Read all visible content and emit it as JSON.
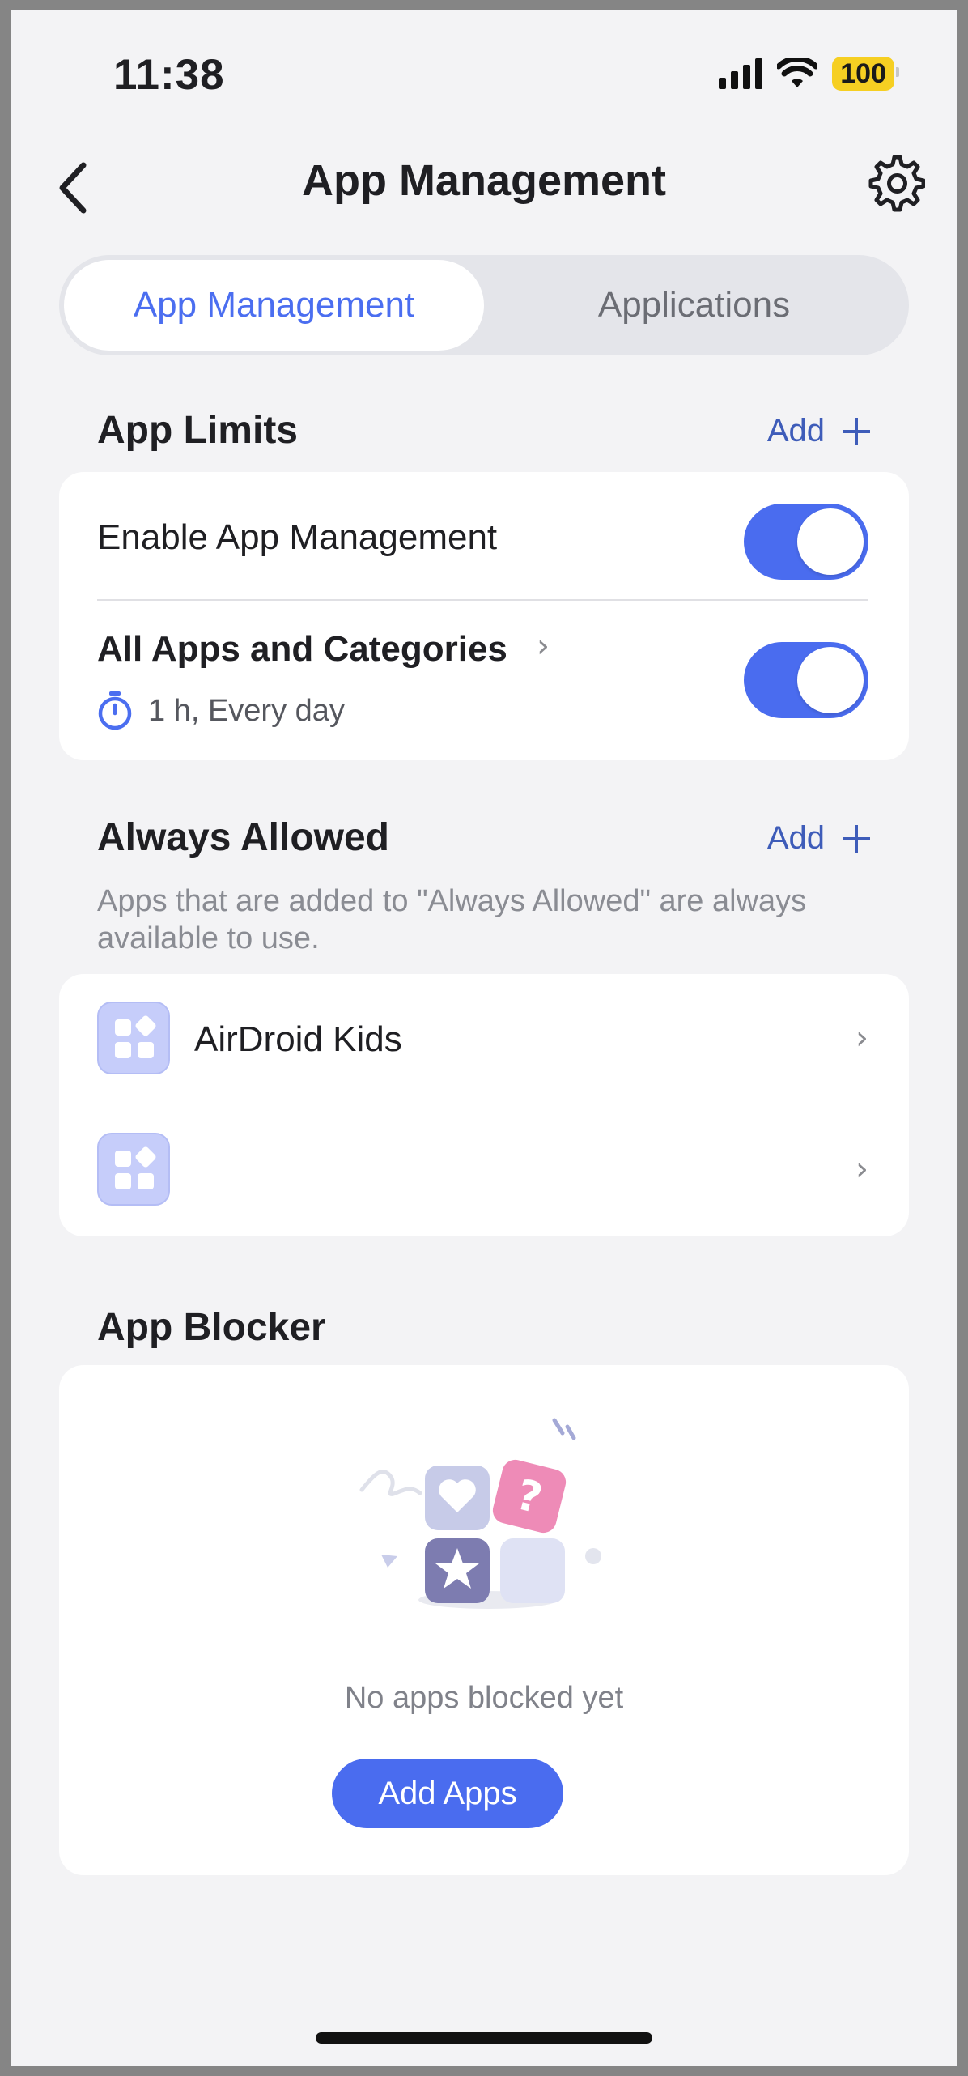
{
  "status_bar": {
    "time": "11:38",
    "battery": "100",
    "icons": [
      "signal-icon",
      "wifi-icon",
      "battery-icon"
    ]
  },
  "nav": {
    "title": "App Management",
    "back_icon": "chevron-left-icon",
    "settings_icon": "gear-icon"
  },
  "tabs": [
    {
      "label": "App Management",
      "active": true
    },
    {
      "label": "Applications",
      "active": false
    }
  ],
  "app_limits": {
    "title": "App Limits",
    "add_label": "Add",
    "enable_label": "Enable App Management",
    "enable_on": true,
    "rule_title": "All Apps and Categories",
    "rule_schedule": "1 h, Every day",
    "rule_on": true
  },
  "always_allowed": {
    "title": "Always Allowed",
    "add_label": "Add",
    "description": "Apps that are added to \"Always Allowed\" are always available to use.",
    "apps": [
      {
        "name": "AirDroid Kids"
      },
      {
        "name": ""
      }
    ]
  },
  "app_blocker": {
    "title": "App Blocker",
    "empty_text": "No apps blocked yet",
    "button_label": "Add Apps"
  },
  "colors": {
    "accent": "#4a6cef",
    "link": "#3e5cb9",
    "background": "#f3f3f5"
  }
}
